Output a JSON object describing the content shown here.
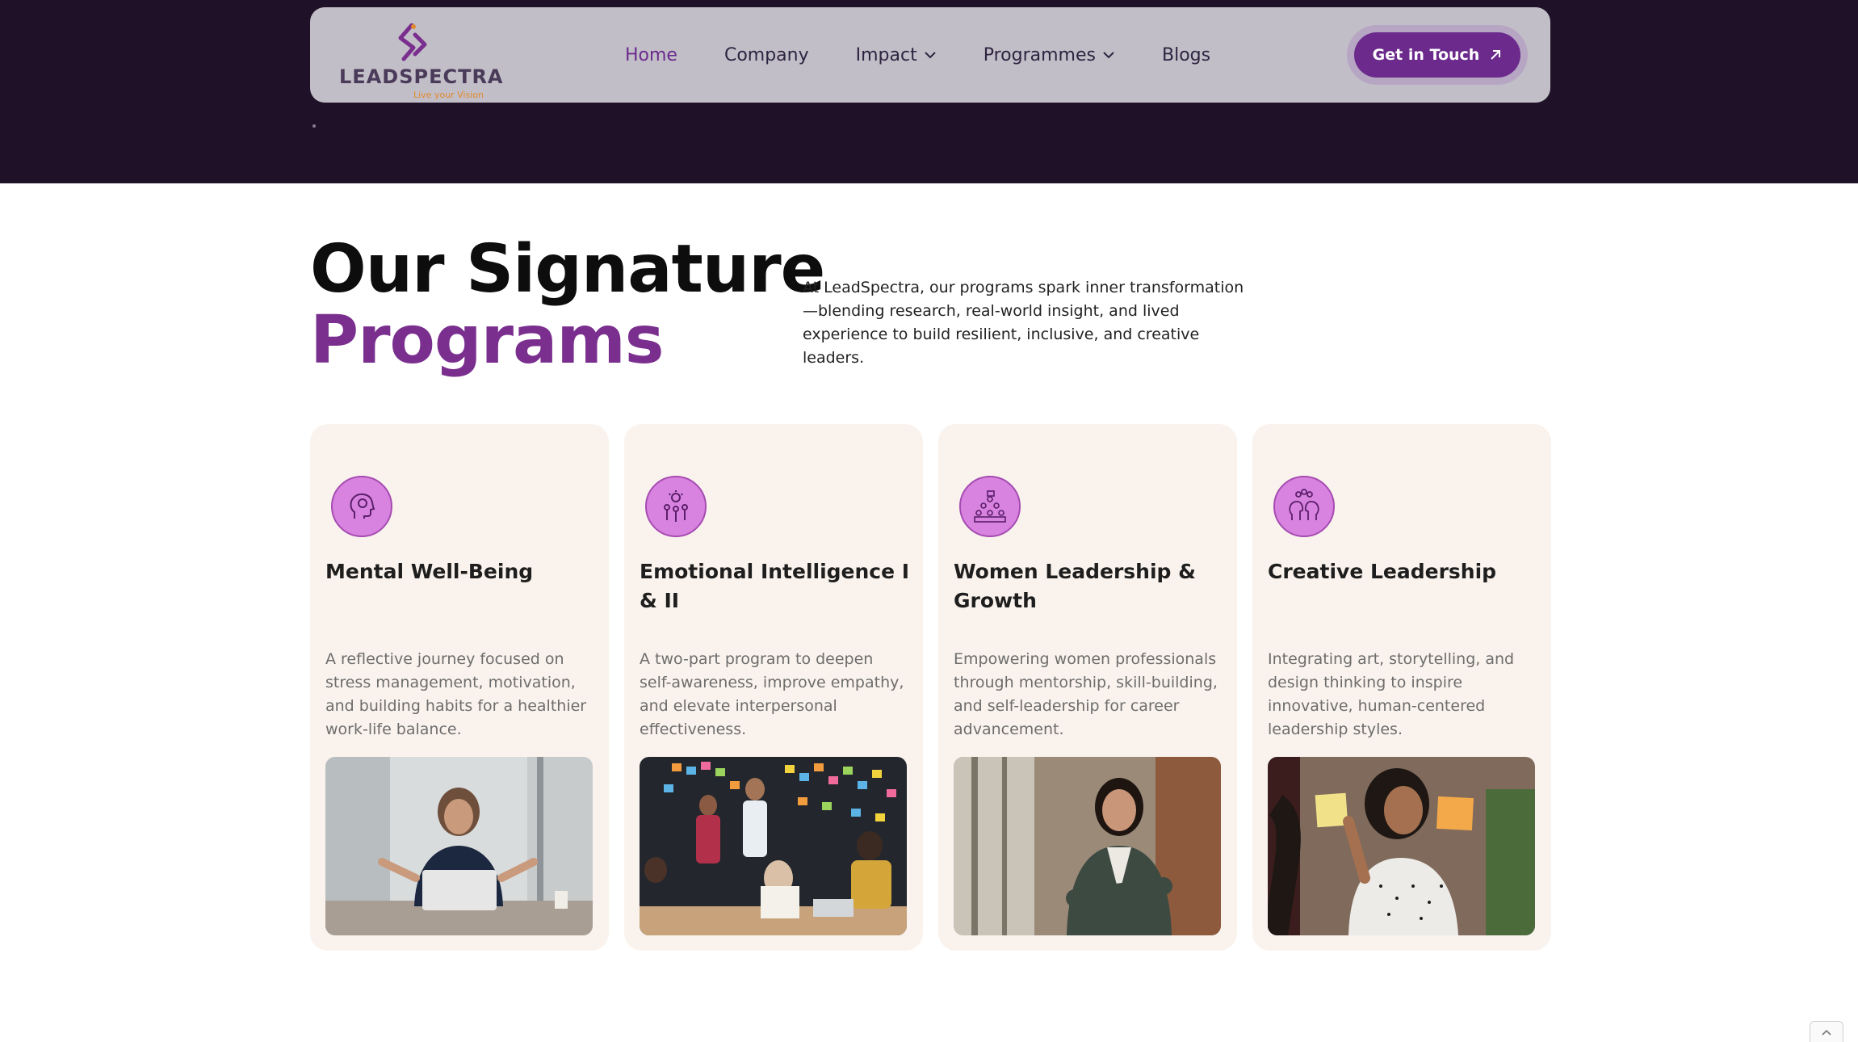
{
  "brand": {
    "logo_text_lead": "LEAD",
    "logo_text_spectra": "SPECTRA",
    "tagline": "Live your Vision",
    "accent": "#6b2a8c",
    "logo_orange": "#e08a2b"
  },
  "nav": {
    "items": [
      {
        "label": "Home",
        "active": true,
        "dropdown": false
      },
      {
        "label": "Company",
        "active": false,
        "dropdown": false
      },
      {
        "label": "Impact",
        "active": false,
        "dropdown": true
      },
      {
        "label": "Programmes",
        "active": false,
        "dropdown": true
      },
      {
        "label": "Blogs",
        "active": false,
        "dropdown": false
      }
    ],
    "cta_label": "Get in Touch",
    "cta_icon": "arrow-up-right-icon"
  },
  "section": {
    "heading_line1": "Our Signature",
    "heading_line2": "Programs",
    "intro": "At LeadSpectra, our programs spark inner transformation —blending research, real-world insight, and lived experience to build resilient, inclusive, and creative leaders."
  },
  "programs": [
    {
      "title": "Mental Well-Being",
      "description": "A reflective journey focused on stress management, motivation, and building habits for a healthier work-life balance.",
      "icon": "mind-head-icon",
      "photo": "woman-meditating-at-laptop"
    },
    {
      "title": "Emotional Intelligence I & II",
      "description": "A two-part program to deepen self-awareness, improve empathy, and elevate interpersonal effectiveness.",
      "icon": "team-idea-icon",
      "photo": "team-workshop-sticky-notes"
    },
    {
      "title": "Women Leadership & Growth",
      "description": "Empowering women professionals through mentorship, skill-building, and self-leadership for career advancement.",
      "icon": "group-pyramid-icon",
      "photo": "confident-businesswoman-portrait"
    },
    {
      "title": "Creative Leadership",
      "description": "Integrating art, storytelling, and design thinking to inspire innovative, human-centered leadership styles.",
      "icon": "creative-heads-icon",
      "photo": "woman-with-sticky-notes"
    }
  ],
  "colors": {
    "hero_band": "#1f1127",
    "card_bg": "#faf3ed",
    "icon_bg": "#d983e0",
    "heading_purple": "#7a2f8f"
  }
}
